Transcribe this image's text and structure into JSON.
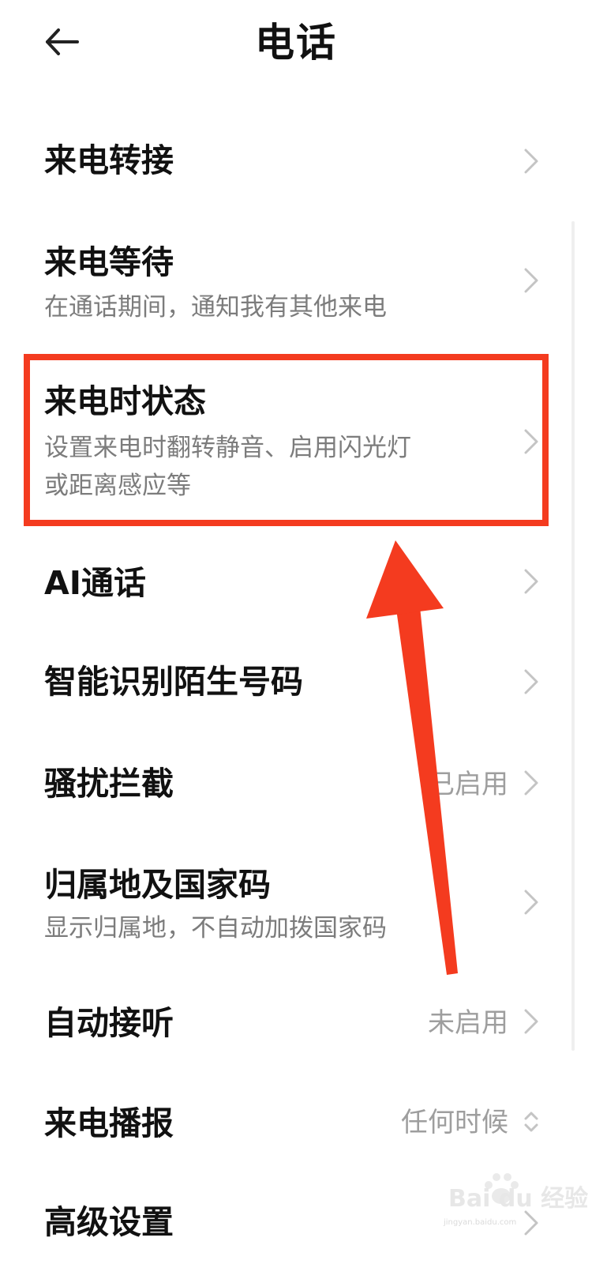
{
  "header": {
    "title": "电话",
    "back_icon": "arrow-left-icon"
  },
  "settings": [
    {
      "title": "来电转接",
      "subtitle": "",
      "value": ""
    },
    {
      "title": "来电等待",
      "subtitle": "在通话期间，通知我有其他来电",
      "value": ""
    },
    {
      "title": "来电时状态",
      "subtitle_line1": "设置来电时翻转静音、启用闪光灯",
      "subtitle_line2": "或距离感应等",
      "value": ""
    },
    {
      "title": "AI通话",
      "subtitle": "",
      "value": ""
    },
    {
      "title": "智能识别陌生号码",
      "subtitle": "",
      "value": ""
    },
    {
      "title": "骚扰拦截",
      "subtitle": "",
      "value": "已启用"
    },
    {
      "title": "归属地及国家码",
      "subtitle": "显示归属地，不自动加拨国家码",
      "value": ""
    },
    {
      "title": "自动接听",
      "subtitle": "",
      "value": "未启用"
    },
    {
      "title": "来电播报",
      "subtitle": "",
      "value": "任何时候"
    },
    {
      "title": "高级设置",
      "subtitle": "",
      "value": ""
    }
  ],
  "annotation": {
    "highlight_color": "#f43b1f",
    "highlighted_item": "来电时状态"
  },
  "watermark": {
    "text": "Bai du 经验",
    "subtext": "jingyan.baidu.com"
  },
  "colors": {
    "title": "#111111",
    "subtitle": "#7c7c7c",
    "value": "#9e9e9e",
    "chevron": "#c4c4c4"
  }
}
